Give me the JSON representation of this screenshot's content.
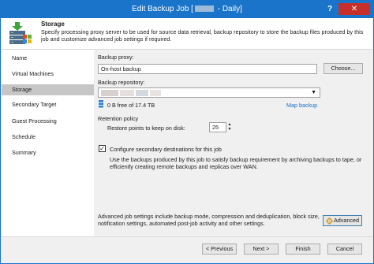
{
  "window": {
    "title_prefix": "Edit Backup Job [",
    "title_suffix": " - Daily]",
    "help_label": "?",
    "close_label": "✕"
  },
  "header": {
    "title": "Storage",
    "description": "Specify processing proxy server to be used for source data retrieval, backup repository to store the backup files produced by this job and customize advanced job settings if required."
  },
  "sidebar": {
    "items": [
      {
        "label": "Name"
      },
      {
        "label": "Virtual Machines"
      },
      {
        "label": "Storage"
      },
      {
        "label": "Secondary Target"
      },
      {
        "label": "Guest Processing"
      },
      {
        "label": "Schedule"
      },
      {
        "label": "Summary"
      }
    ],
    "active_index": 2
  },
  "storage": {
    "proxy_label": "Backup proxy:",
    "proxy_value": "On-host backup",
    "choose_label": "Choose...",
    "repository_label": "Backup repository:",
    "repository_free": "0 B free of 17.4 TB",
    "map_backup_label": "Map backup",
    "retention_label": "Retention policy",
    "restore_points_label": "Restore points to keep on disk:",
    "restore_points_value": "25",
    "secondary_checkbox_label": "Configure secondary destinations for this job",
    "secondary_checked": true,
    "secondary_desc": "Use the backups produced by this job to satisfy backup requirement by archiving backups to tape, or efficiently creating remote backups and replicas over WAN.",
    "advanced_desc": "Advanced job settings include backup mode, compression and deduplication, block size, notification settings, automated post-job activity and other settings.",
    "advanced_label": "Advanced"
  },
  "footer": {
    "previous_label": "< Previous",
    "next_label": "Next >",
    "finish_label": "Finish",
    "cancel_label": "Cancel"
  },
  "colors": {
    "titlebar": "#1a74c9",
    "link": "#1a6fc7",
    "active_nav": "#c6c6c6"
  }
}
